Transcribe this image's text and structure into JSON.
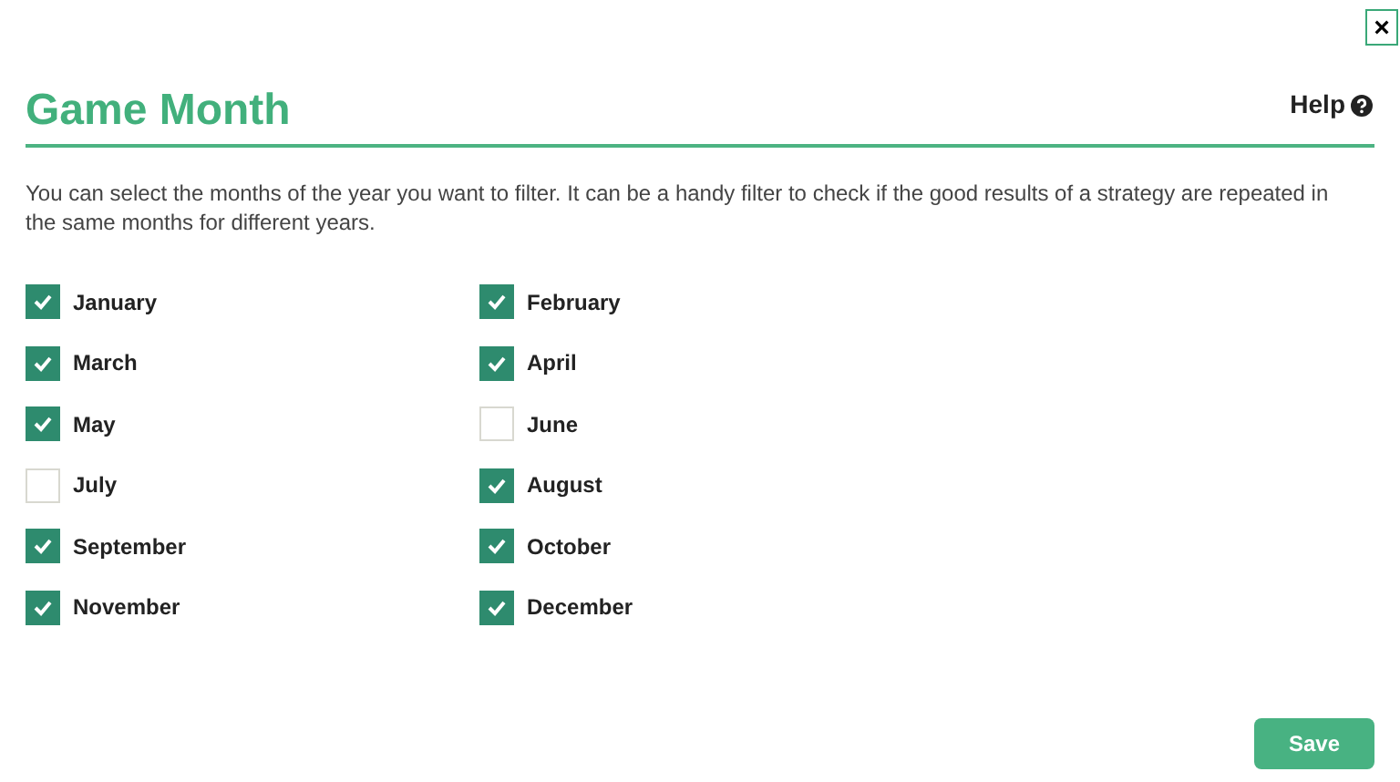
{
  "close_button": "×",
  "title": "Game Month",
  "help_link": "Help",
  "description": "You can select the months of the year you want to filter. It can be a handy filter to check if the good results of a strategy are repeated in the same months for different years.",
  "months": [
    {
      "label": "January",
      "checked": true
    },
    {
      "label": "February",
      "checked": true
    },
    {
      "label": "March",
      "checked": true
    },
    {
      "label": "April",
      "checked": true
    },
    {
      "label": "May",
      "checked": true
    },
    {
      "label": "June",
      "checked": false
    },
    {
      "label": "July",
      "checked": false
    },
    {
      "label": "August",
      "checked": true
    },
    {
      "label": "September",
      "checked": true
    },
    {
      "label": "October",
      "checked": true
    },
    {
      "label": "November",
      "checked": true
    },
    {
      "label": "December",
      "checked": true
    }
  ],
  "save_button": "Save"
}
